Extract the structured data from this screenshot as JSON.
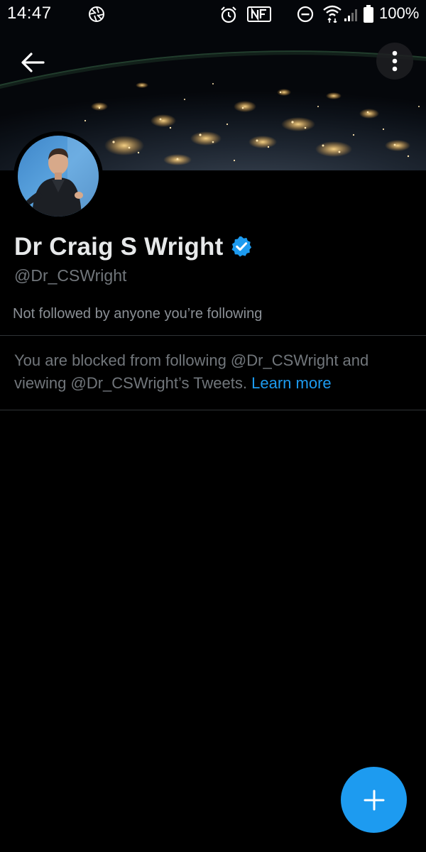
{
  "status_bar": {
    "time": "14:47",
    "battery_percent": "100%",
    "icons": [
      "camera-aperture-icon",
      "alarm-icon",
      "nfc-icon",
      "do-not-disturb-icon",
      "wifi-icon",
      "cell-signal-icon",
      "battery-icon"
    ]
  },
  "header": {
    "back_icon": "arrow-left-icon",
    "more_icon": "vertical-dots-icon",
    "banner": "earth-at-night-photo"
  },
  "profile": {
    "display_name": "Dr Craig S Wright",
    "verified_icon": "verified-badge-icon",
    "handle": "@Dr_CSWright",
    "followed_by": "Not followed by anyone you’re following",
    "blocked_message": "You are blocked from following @Dr_CSWright and viewing @Dr_CSWright’s Tweets.",
    "learn_more_label": "Learn more"
  },
  "fab": {
    "icon": "plus-icon"
  },
  "colors": {
    "accent": "#1d9bf0",
    "background": "#000000",
    "primary_text": "#e7e9ea",
    "secondary_text": "#71767b",
    "divider": "#2f3336"
  }
}
